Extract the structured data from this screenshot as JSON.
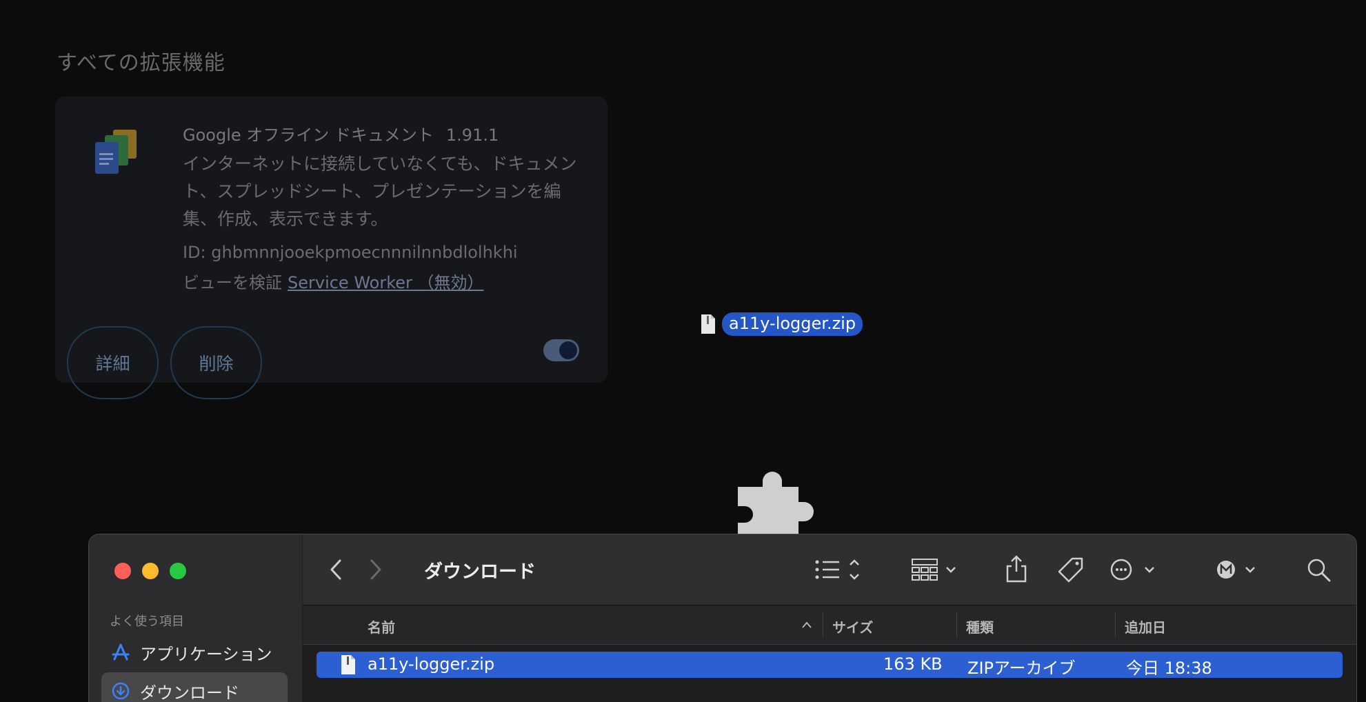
{
  "extensions_page": {
    "section_title": "すべての拡張機能",
    "extension": {
      "name": "Google オフライン ドキュメント",
      "version": "1.91.1",
      "description": "インターネットに接続していなくても、ドキュメント、スプレッドシート、プレゼンテーションを編集、作成、表示できます。",
      "id_text": "ID: ghbmnnjooekpmoecnnnilnnbdlolhkhi",
      "views_label": "ビューを検証",
      "service_worker_link": "Service Worker （無効）",
      "details_button": "詳細",
      "remove_button": "削除",
      "enabled": true
    }
  },
  "drag": {
    "file_label": "a11y-logger.zip"
  },
  "finder": {
    "sidebar": {
      "section_header": "よく使う項目",
      "items": [
        {
          "label": "アプリケーション",
          "icon": "apps-icon"
        },
        {
          "label": "ダウンロード",
          "icon": "download-icon",
          "selected": true
        }
      ]
    },
    "toolbar": {
      "title": "ダウンロード"
    },
    "columns": {
      "name": "名前",
      "size": "サイズ",
      "kind": "種類",
      "date_added": "追加日"
    },
    "rows": [
      {
        "name": "a11y-logger.zip",
        "size": "163 KB",
        "kind": "ZIPアーカイブ",
        "date_added": "今日 18:38",
        "selected": true
      }
    ]
  },
  "colors": {
    "selection": "#2b5fd2",
    "toggle_track": "#4b5a78"
  }
}
